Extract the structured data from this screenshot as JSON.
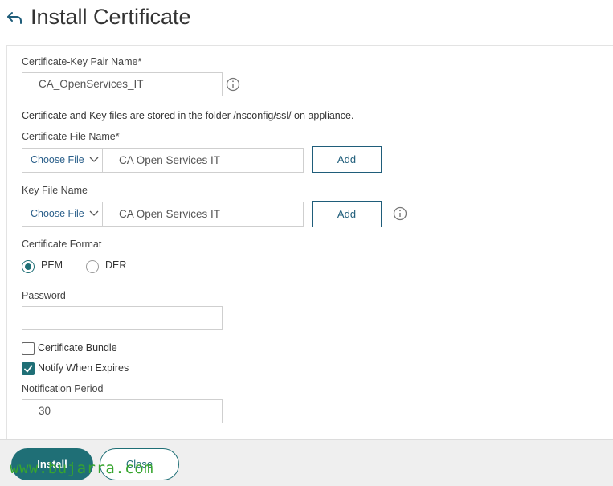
{
  "header": {
    "title": "Install Certificate"
  },
  "form": {
    "cert_key_pair_label": "Certificate-Key Pair Name*",
    "cert_key_pair_value": "CA_OpenServices_IT",
    "folder_note": "Certificate and Key files are stored in the folder /nsconfig/ssl/ on appliance.",
    "cert_file_label": "Certificate File Name*",
    "cert_file_choose": "Choose File",
    "cert_file_value": "CA Open Services IT",
    "cert_file_add": "Add",
    "key_file_label": "Key File Name",
    "key_file_choose": "Choose File",
    "key_file_value": "CA Open Services IT",
    "key_file_add": "Add",
    "format_label": "Certificate Format",
    "format_options": [
      "PEM",
      "DER"
    ],
    "format_selected": "PEM",
    "password_label": "Password",
    "password_value": "",
    "bundle_label": "Certificate Bundle",
    "bundle_checked": false,
    "notify_label": "Notify When Expires",
    "notify_checked": true,
    "period_label": "Notification Period",
    "period_value": "30"
  },
  "footer": {
    "install_label": "Install",
    "close_label": "Close",
    "watermark": "www.bujarra.com"
  },
  "colors": {
    "accent": "#1f6f76",
    "link": "#1f5d7a",
    "watermark": "#37a52e"
  },
  "icons": [
    "back-arrow-icon",
    "info-icon",
    "chevron-down-icon",
    "checkmark-icon"
  ]
}
